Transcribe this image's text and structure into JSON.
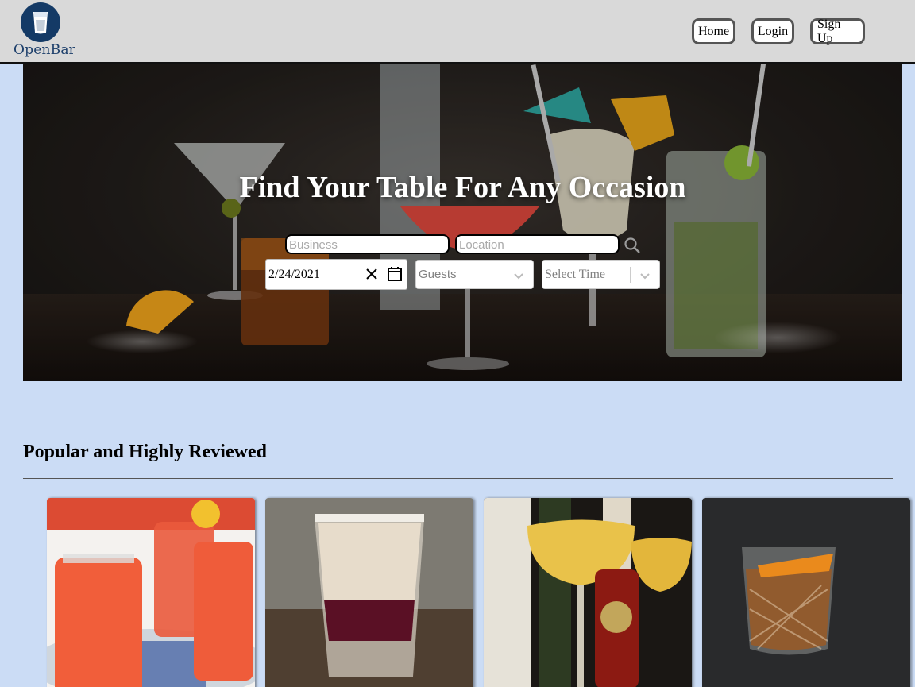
{
  "header": {
    "logo_text": "OpenBar",
    "nav": {
      "home": "Home",
      "login": "Login",
      "signup": "Sign Up"
    }
  },
  "hero": {
    "title": "Find Your Table For Any Occasion",
    "business_placeholder": "Business",
    "location_placeholder": "Location",
    "date_value": "2/24/2021",
    "guests_placeholder": "Guests",
    "time_placeholder": "Select Time"
  },
  "popular": {
    "title": "Popular and Highly Reviewed"
  }
}
